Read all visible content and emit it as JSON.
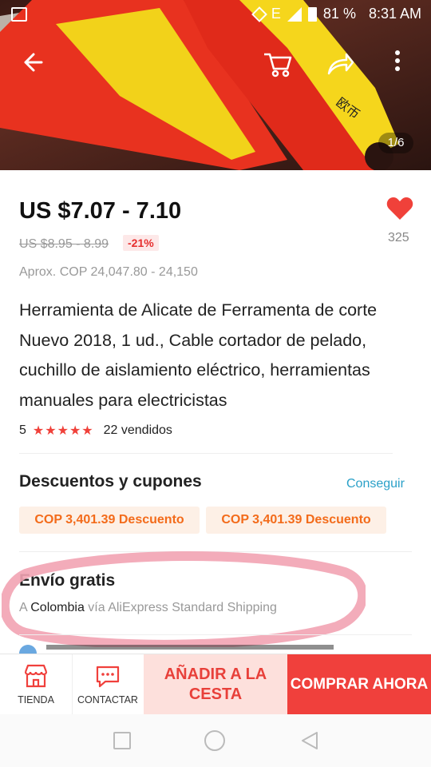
{
  "status_bar": {
    "battery": "81 %",
    "time": "8:31 AM",
    "network": "E"
  },
  "hero": {
    "pager": "1/6"
  },
  "product": {
    "price": "US $7.07 - 7.10",
    "original_price": "US $8.95 - 8.99",
    "discount": "-21%",
    "approx_price": "Aprox. COP 24,047.80 - 24,150",
    "likes": "325",
    "title": "Herramienta de Alicate de Ferramenta de corte Nuevo 2018, 1 ud., Cable cortador de pelado, cuchillo de aislamiento eléctrico, herramientas manuales para electricistas",
    "rating": "5",
    "stars": "★★★★★",
    "sold": "22 vendidos"
  },
  "discounts": {
    "title": "Descuentos y cupones",
    "link": "Conseguir",
    "coupons": [
      "COP 3,401.39 Descuento",
      "COP 3,401.39 Descuento"
    ]
  },
  "shipping": {
    "title": "Envío gratis",
    "prefix": "A",
    "country": "Colombia",
    "method": "vía AliExpress Standard Shipping"
  },
  "actions": {
    "store": "TIENDA",
    "contact": "CONTACTAR",
    "add_to_cart": "AÑADIR A LA CESTA",
    "buy_now": "COMPRAR AHORA"
  },
  "colors": {
    "accent": "#f0403c",
    "link": "#2aa0c8",
    "coupon": "#f36b1a"
  }
}
